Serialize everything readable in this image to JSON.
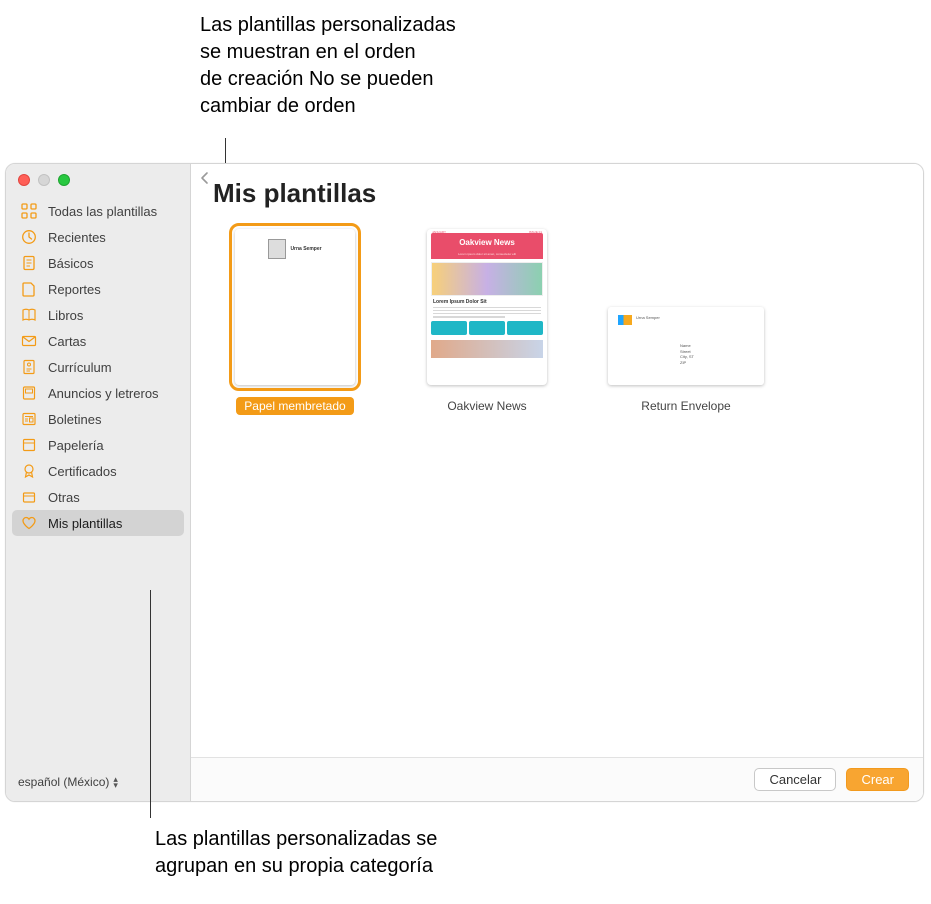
{
  "callouts": {
    "top": "Las plantillas personalizadas\nse muestran en el orden\nde creación No se pueden\ncambiar de orden",
    "bottom": "Las plantillas personalizadas se\nagrupan en su propia categoría"
  },
  "sidebar": {
    "items": [
      {
        "label": "Todas las plantillas",
        "icon": "grid"
      },
      {
        "label": "Recientes",
        "icon": "clock"
      },
      {
        "label": "Básicos",
        "icon": "doc"
      },
      {
        "label": "Reportes",
        "icon": "report"
      },
      {
        "label": "Libros",
        "icon": "book"
      },
      {
        "label": "Cartas",
        "icon": "envelope"
      },
      {
        "label": "Currículum",
        "icon": "cv"
      },
      {
        "label": "Anuncios y letreros",
        "icon": "flyer"
      },
      {
        "label": "Boletines",
        "icon": "news"
      },
      {
        "label": "Papelería",
        "icon": "stationery"
      },
      {
        "label": "Certificados",
        "icon": "ribbon"
      },
      {
        "label": "Otras",
        "icon": "box"
      },
      {
        "label": "Mis plantillas",
        "icon": "heart"
      }
    ],
    "selected_index": 12,
    "language": "español (México)"
  },
  "main": {
    "title": "Mis plantillas",
    "templates": [
      {
        "label": "Papel membretado",
        "selected": true
      },
      {
        "label": "Oakview News",
        "selected": false,
        "nameplate": "Oakview News",
        "headline": "Lorem Ipsum Dolor Sit"
      },
      {
        "label": "Return Envelope",
        "selected": false
      }
    ]
  },
  "footer": {
    "cancel_label": "Cancelar",
    "create_label": "Crear"
  }
}
